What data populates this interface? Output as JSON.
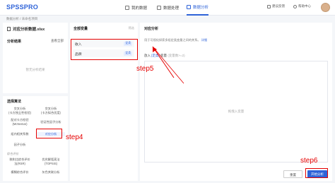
{
  "app": {
    "logo": "SPSSPRO"
  },
  "nav": {
    "items": [
      {
        "label": "我的数据",
        "active": false
      },
      {
        "label": "数据处理",
        "active": false
      },
      {
        "label": "数据分析",
        "active": true
      }
    ],
    "feedback": "建议反馈",
    "help": "帮助中心"
  },
  "breadcrumb": "数据分析 / 未命名项目",
  "sidebar": {
    "file_name": "对应分析数据.xlsx",
    "results_title": "分析结果",
    "view_all": "查看全部",
    "empty": "暂无分析结果",
    "algo_title": "选择算法",
    "algos": [
      {
        "label": "交叉分析\n(卡方独立性检验)"
      },
      {
        "label": "交叉分析\n(卡方拟合优度)"
      },
      {
        "label": "配对卡方检验\n(McNemar)"
      },
      {
        "label": "验证性因子分析"
      },
      {
        "label": "组内相关系数"
      },
      {
        "label": "对应分析",
        "selected": true
      },
      {
        "label": "因子分析"
      }
    ],
    "sub_title": "综合评价",
    "sub_algos": [
      {
        "label": "秩和比综合评价\n法(RSR)"
      },
      {
        "label": "优劣解距离法\n(TOPSIS)"
      },
      {
        "label": "模糊综合评价"
      },
      {
        "label": "灰色关联分析"
      }
    ]
  },
  "variables": {
    "title": "全部变量",
    "filter": "筛选",
    "items": [
      {
        "name": "收入",
        "tag": "定类"
      },
      {
        "name": "品牌",
        "tag": "定类"
      }
    ]
  },
  "main": {
    "title": "对应分析",
    "desc": "用于可视化探索多组定类变量之间的关系。",
    "desc_link": "详细",
    "field_prefix": "放入",
    "field_tag": "[定类]",
    "field_suffix": "变量",
    "field_hint": "(变量数>=2)",
    "drop_placeholder": "拖拽入变量",
    "reset_label": "重置",
    "start_label": "开始分析"
  },
  "annotations": {
    "step4": "step4",
    "step5": "step5",
    "step6": "step6",
    "color": "#e60000"
  }
}
